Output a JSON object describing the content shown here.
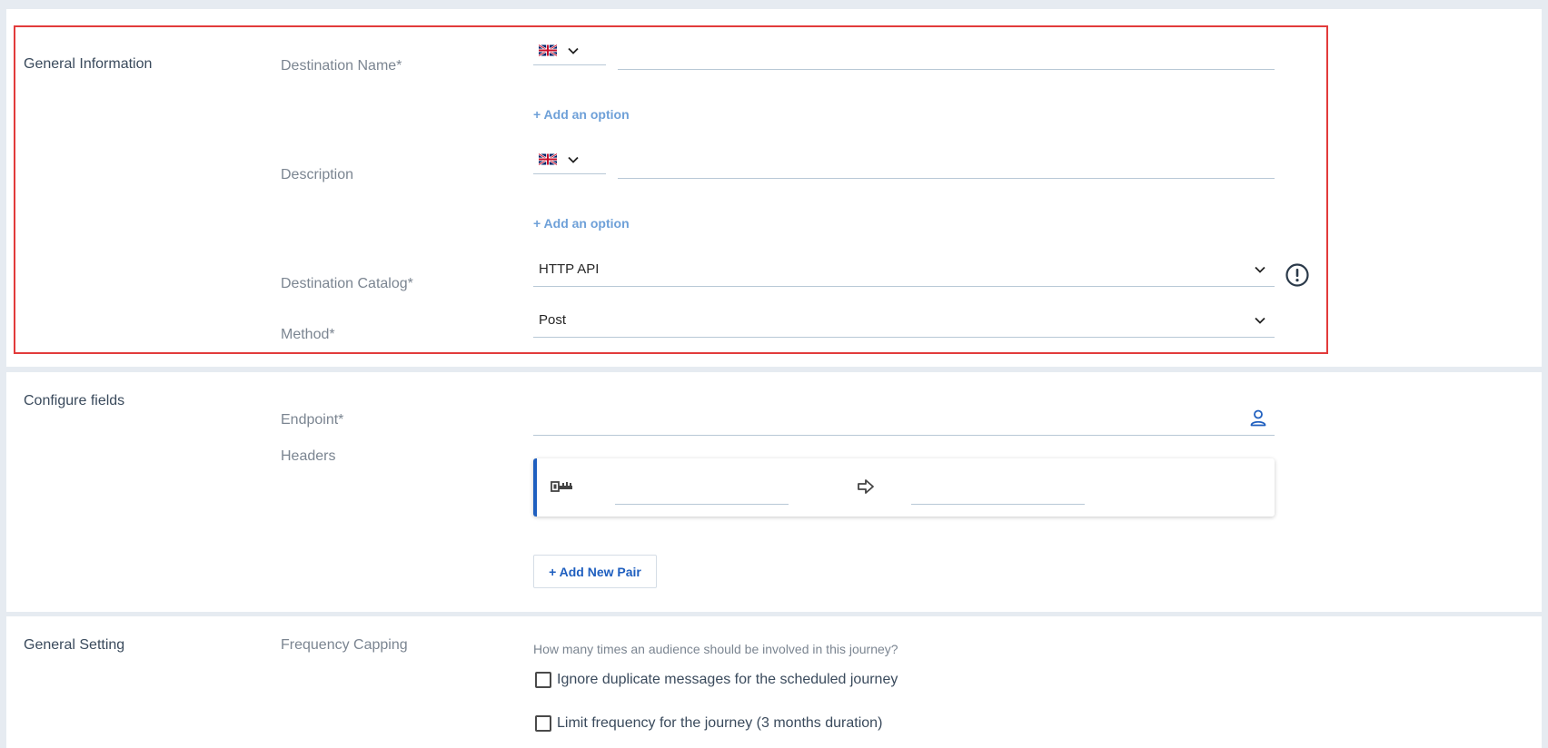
{
  "general_information": {
    "title": "General Information",
    "destination_name": {
      "label": "Destination Name*",
      "value": "",
      "add_option": "+ Add an option"
    },
    "description": {
      "label": "Description",
      "value": "",
      "add_option": "+ Add an option"
    },
    "destination_catalog": {
      "label": "Destination Catalog*",
      "value": "HTTP API"
    },
    "method": {
      "label": "Method*",
      "value": "Post"
    }
  },
  "configure_fields": {
    "title": "Configure fields",
    "endpoint": {
      "label": "Endpoint*",
      "value": ""
    },
    "headers": {
      "label": "Headers",
      "key": "",
      "value": ""
    },
    "add_pair_label": "+ Add New Pair"
  },
  "general_setting": {
    "title": "General Setting",
    "frequency_capping": {
      "label": "Frequency Capping",
      "question": "How many times an audience should be involved in this journey?",
      "options": [
        {
          "label": "Ignore duplicate messages for the scheduled journey",
          "checked": false
        },
        {
          "label": "Limit frequency for the journey (3 months duration)",
          "checked": false
        }
      ]
    }
  },
  "icons": {
    "language": "uk-flag-icon",
    "dropdown": "chevron-down-icon",
    "info": "exclamation-circle-icon",
    "personalize": "person-icon",
    "header_key": "key-icon",
    "header_arrow": "arrow-right-icon"
  },
  "colors": {
    "accent": "#1f5fbf",
    "highlight": "#e23b3b",
    "link": "#6ea0d8"
  }
}
